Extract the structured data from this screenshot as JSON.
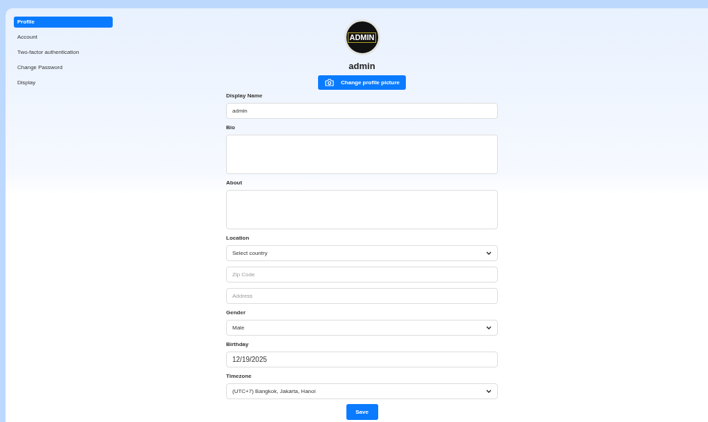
{
  "sidebar": {
    "items": [
      {
        "label": "Profile",
        "selected": true
      },
      {
        "label": "Account",
        "selected": false
      },
      {
        "label": "Two-factor authentication",
        "selected": false
      },
      {
        "label": "Change Password",
        "selected": false
      },
      {
        "label": "Display",
        "selected": false
      }
    ]
  },
  "profile": {
    "avatar_text": "ADMIN",
    "name": "admin",
    "change_picture_button": "Change profile picture"
  },
  "form": [
    {
      "label": "Display Name",
      "fields": [
        {
          "kind": "text",
          "value": "admin"
        }
      ]
    },
    {
      "label": "Bio",
      "fields": [
        {
          "kind": "textarea"
        }
      ]
    },
    {
      "label": "About",
      "fields": [
        {
          "kind": "textarea"
        }
      ]
    },
    {
      "label": "Location",
      "fields": [
        {
          "kind": "select",
          "value": "Select country"
        },
        {
          "kind": "text",
          "placeholder": "Zip Code"
        },
        {
          "kind": "text",
          "placeholder": "Address"
        }
      ]
    },
    {
      "label": "Gender",
      "fields": [
        {
          "kind": "select",
          "value": "Male"
        }
      ]
    },
    {
      "label": "Birthday",
      "fields": [
        {
          "kind": "date",
          "value": "12/19/2025"
        }
      ]
    },
    {
      "label": "Timezone",
      "fields": [
        {
          "kind": "select",
          "value": "(UTC+7) Bangkok, Jakarta, Hanoi"
        }
      ]
    }
  ],
  "save_button": "Save"
}
